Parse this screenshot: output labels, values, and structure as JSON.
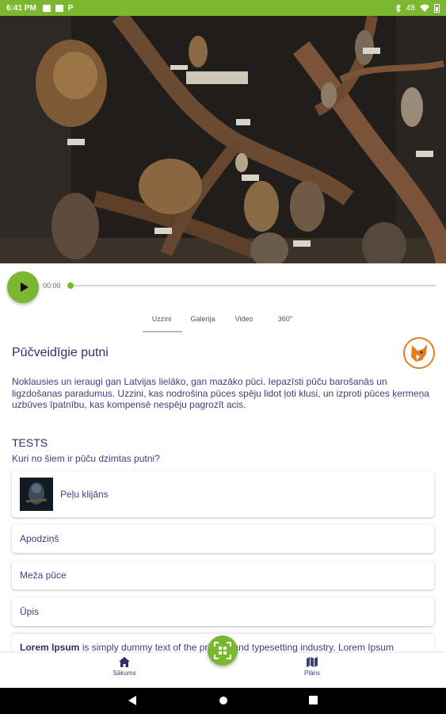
{
  "status_bar": {
    "time": "6:41 PM",
    "notification_icons": [
      "image-icon",
      "youtube-icon",
      "p-app-icon"
    ],
    "p_app_glyph": "P",
    "system_icons": [
      "bluetooth-icon",
      "wifi-icon",
      "battery-icon"
    ],
    "battery_label": "48"
  },
  "hero": {
    "image": "owl-diorama-photo"
  },
  "player": {
    "elapsed": "00:00",
    "progress": 0
  },
  "tabs": [
    {
      "label": "Uzzini",
      "active": true
    },
    {
      "label": "Galerija",
      "active": false
    },
    {
      "label": "Video",
      "active": false
    },
    {
      "label": "360°",
      "active": false
    }
  ],
  "article": {
    "title": "Pūčveidīgie putni",
    "description": "Noklausies un ieraugi gan Latvijas lielāko, gan mazāko pūci. Iepazīsti pūču barošanās un ligzdošanas paradumus. Uzzini, kas nodrošina pūces spēju lidot ļoti klusi, un izproti pūces ķermeņa uzbūves īpatnību, kas kompensē nespēju pagrozīt acis."
  },
  "quiz": {
    "title": "TESTS",
    "question": "Kuri no šiem ir pūču dzimtas putni?",
    "answers": [
      {
        "label": "Peļu klijāns",
        "has_image": true
      },
      {
        "label": "Apodziņš",
        "has_image": false
      },
      {
        "label": "Meža pūce",
        "has_image": false
      },
      {
        "label": "Ūpis",
        "has_image": false
      }
    ]
  },
  "lorem": {
    "bold": "Lorem Ipsum",
    "text": " is simply dummy text of the printing and typesetting industry. Lorem Ipsum"
  },
  "bottom_nav": {
    "home_label": "Sākums",
    "map_label": "Plāns"
  },
  "colors": {
    "accent": "#7cb82f",
    "text": "#2b2f6b",
    "fox_orange": "#e47e1e"
  }
}
